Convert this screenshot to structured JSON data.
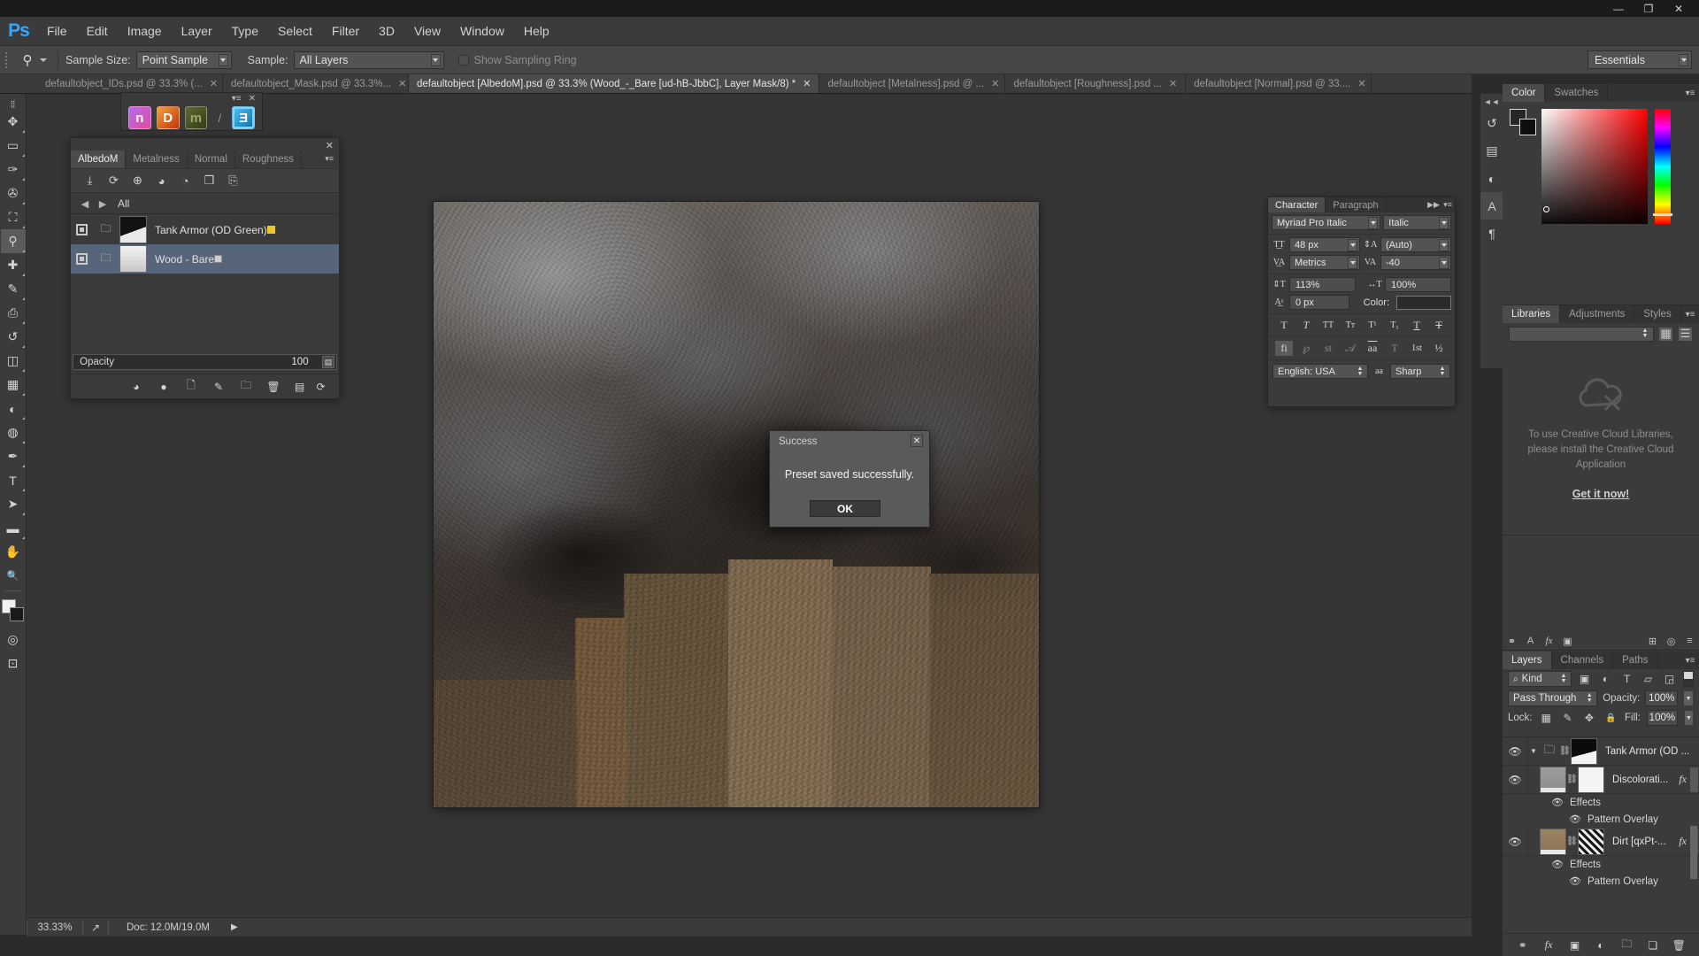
{
  "window": {
    "minimize": "—",
    "maximize": "❐",
    "close": "✕"
  },
  "menubar": {
    "logo": "Ps",
    "items": [
      "File",
      "Edit",
      "Image",
      "Layer",
      "Type",
      "Select",
      "Filter",
      "3D",
      "View",
      "Window",
      "Help"
    ]
  },
  "options_bar": {
    "sample_size_label": "Sample Size:",
    "sample_size_value": "Point Sample",
    "sample_label": "Sample:",
    "sample_value": "All Layers",
    "show_sampling_ring": "Show Sampling Ring",
    "workspace": "Essentials"
  },
  "tabs": [
    {
      "label": "defaultobject_IDs.psd @ 33.3% (...",
      "active": false,
      "close": "✕"
    },
    {
      "label": "defaultobject_Mask.psd @ 33.3%...",
      "active": false,
      "close": "✕"
    },
    {
      "label": "defaultobject [AlbedoM].psd @ 33.3% (Wood_-_Bare [ud-hB-JbbC], Layer Mask/8) *",
      "active": true,
      "close": "✕"
    },
    {
      "label": "defaultobject [Metalness].psd @ ...",
      "active": false,
      "close": "✕"
    },
    {
      "label": "defaultobject [Roughness].psd ...",
      "active": false,
      "close": "✕"
    },
    {
      "label": "defaultobject [Normal].psd @ 33....",
      "active": false,
      "close": "✕"
    }
  ],
  "toolbar": {
    "tools": [
      {
        "name": "move-tool",
        "glyph": "✥"
      },
      {
        "name": "marquee-tool",
        "glyph": "▭"
      },
      {
        "name": "lasso-tool",
        "glyph": "✑"
      },
      {
        "name": "quick-selection-tool",
        "glyph": "✇"
      },
      {
        "name": "crop-tool",
        "glyph": "⛶"
      },
      {
        "name": "eyedropper-tool",
        "glyph": "⚲"
      },
      {
        "name": "spot-healing-tool",
        "glyph": "✚"
      },
      {
        "name": "brush-tool",
        "glyph": "✎"
      },
      {
        "name": "clone-stamp-tool",
        "glyph": "⎙"
      },
      {
        "name": "history-brush-tool",
        "glyph": "↺"
      },
      {
        "name": "eraser-tool",
        "glyph": "◫"
      },
      {
        "name": "gradient-tool",
        "glyph": "▦"
      },
      {
        "name": "blur-tool",
        "glyph": "◐"
      },
      {
        "name": "dodge-tool",
        "glyph": "◍"
      },
      {
        "name": "pen-tool",
        "glyph": "✒"
      },
      {
        "name": "type-tool",
        "glyph": "T"
      },
      {
        "name": "path-selection-tool",
        "glyph": "➤"
      },
      {
        "name": "rectangle-tool",
        "glyph": "▬"
      },
      {
        "name": "hand-tool",
        "glyph": "✋"
      },
      {
        "name": "zoom-tool",
        "glyph": "🔍"
      }
    ],
    "extra": [
      {
        "name": "quick-mask-icon",
        "glyph": "◎"
      },
      {
        "name": "screen-mode-icon",
        "glyph": "⊡"
      }
    ]
  },
  "material_icons": {
    "menu_glyph": "▾≡",
    "close_glyph": "✕",
    "items": [
      {
        "name": "normal-material-icon",
        "label": "n"
      },
      {
        "name": "diffuse-material-icon",
        "label": "D"
      },
      {
        "name": "metalness-material-icon",
        "label": "m"
      },
      {
        "name": "separator-icon",
        "label": "/"
      },
      {
        "name": "export-material-icon",
        "label": "Ǝ"
      }
    ]
  },
  "material_panel": {
    "close": "✕",
    "menu": "▾≡",
    "tabs": [
      {
        "label": "AlbedoM",
        "active": true
      },
      {
        "label": "Metalness",
        "active": false
      },
      {
        "label": "Normal",
        "active": false
      },
      {
        "label": "Roughness",
        "active": false
      }
    ],
    "tools": [
      {
        "name": "import-icon",
        "glyph": "⤓"
      },
      {
        "name": "refresh-icon",
        "glyph": "⟳"
      },
      {
        "name": "add-layer-icon",
        "glyph": "⊕"
      },
      {
        "name": "apply-icon",
        "glyph": "◕"
      },
      {
        "name": "paint-icon",
        "glyph": "◔"
      },
      {
        "name": "duplicate-icon",
        "glyph": "❐"
      },
      {
        "name": "export-icon",
        "glyph": "⎘"
      }
    ],
    "nav": {
      "prev": "◀",
      "next": "▶",
      "label": "All"
    },
    "items": [
      {
        "name": "Tank Armor (OD Green)",
        "selected": false,
        "swatch": "#e8c832"
      },
      {
        "name": "Wood - Bare",
        "selected": true,
        "swatch": "#cfcfcf"
      }
    ],
    "opacity_label": "Opacity",
    "opacity_value": "100",
    "footer_icons": [
      {
        "name": "mask-icon",
        "glyph": "◕"
      },
      {
        "name": "adjustment-icon",
        "glyph": "●"
      },
      {
        "name": "new-layer-icon",
        "glyph": "🗋"
      },
      {
        "name": "brush-icon",
        "glyph": "✎"
      },
      {
        "name": "folder-icon",
        "glyph": "🗀"
      },
      {
        "name": "delete-icon",
        "glyph": "🗑"
      },
      {
        "name": "sync-icon",
        "glyph": "⟳"
      },
      {
        "name": "save-icon",
        "glyph": "▤"
      }
    ]
  },
  "dialog": {
    "title": "Success",
    "close": "✕",
    "message": "Preset saved successfully.",
    "ok_label": "OK"
  },
  "status_bar": {
    "zoom": "33.33%",
    "share_icon": "↗",
    "doc_label": "Doc: 12.0M/19.0M",
    "arrow": "▶"
  },
  "dock_strip": {
    "icons": [
      {
        "name": "history-dock-icon",
        "glyph": "↺",
        "selected": false
      },
      {
        "name": "properties-dock-icon",
        "glyph": "▤",
        "selected": false
      },
      {
        "name": "adjustments-dock-icon",
        "glyph": "◐",
        "selected": false
      },
      {
        "name": "character-dock-icon",
        "glyph": "A",
        "selected": true
      },
      {
        "name": "paragraph-dock-icon",
        "glyph": "¶",
        "selected": false
      }
    ]
  },
  "color_panel": {
    "tabs": [
      {
        "label": "Color",
        "active": true
      },
      {
        "label": "Swatches",
        "active": false
      }
    ],
    "menu": "▾≡",
    "foreground": "#262626",
    "background": "#0f0f0f"
  },
  "libraries_panel": {
    "tabs": [
      {
        "label": "Libraries",
        "active": true
      },
      {
        "label": "Adjustments",
        "active": false
      },
      {
        "label": "Styles",
        "active": false
      }
    ],
    "menu": "▾≡",
    "message_line1": "To use Creative Cloud Libraries,",
    "message_line2": "please install the Creative Cloud",
    "message_line3": "Application",
    "link": "Get it now!",
    "grid_icon": "▦",
    "list_icon": "☰"
  },
  "icon_strip": {
    "icons": [
      {
        "name": "link-layers-icon",
        "glyph": "⚭"
      },
      {
        "name": "text-icon",
        "glyph": "A"
      },
      {
        "name": "fx-icon",
        "glyph": "fx"
      },
      {
        "name": "mask-icon",
        "glyph": "▣"
      },
      {
        "name": "grid-icon",
        "glyph": "⊞"
      },
      {
        "name": "circle-icon",
        "glyph": "◎"
      },
      {
        "name": "menu-icon",
        "glyph": "≡"
      }
    ]
  },
  "layers_panel": {
    "tabs": [
      {
        "label": "Layers",
        "active": true
      },
      {
        "label": "Channels",
        "active": false
      },
      {
        "label": "Paths",
        "active": false
      }
    ],
    "menu": "▾≡",
    "filter_kind": "Kind",
    "filter_icons": [
      {
        "name": "filter-image-icon",
        "glyph": "▣"
      },
      {
        "name": "filter-adjustment-icon",
        "glyph": "◐"
      },
      {
        "name": "filter-type-icon",
        "glyph": "T"
      },
      {
        "name": "filter-shape-icon",
        "glyph": "▱"
      },
      {
        "name": "filter-smart-object-icon",
        "glyph": "◲"
      }
    ],
    "blend_mode": "Pass Through",
    "opacity_label": "Opacity:",
    "opacity_value": "100%",
    "lock_label": "Lock:",
    "lock_icons": [
      {
        "name": "lock-transparency-icon",
        "glyph": "▦"
      },
      {
        "name": "lock-image-icon",
        "glyph": "✎"
      },
      {
        "name": "lock-position-icon",
        "glyph": "✥"
      },
      {
        "name": "lock-all-icon",
        "glyph": "🔒"
      }
    ],
    "fill_label": "Fill:",
    "fill_value": "100%",
    "layers": [
      {
        "name": "Tank Armor (OD ...",
        "type": "group",
        "expanded": true,
        "fx": "",
        "effects": []
      },
      {
        "name": "Discolorati...",
        "type": "layer",
        "fx": "fx",
        "effects": [
          "Effects",
          "Pattern Overlay"
        ]
      },
      {
        "name": "Dirt [qxPt-...",
        "type": "layer",
        "fx": "fx",
        "effects": [
          "Effects",
          "Pattern Overlay"
        ]
      }
    ],
    "footer_icons": [
      {
        "name": "link-layers-icon",
        "glyph": "⚭"
      },
      {
        "name": "layer-style-icon",
        "glyph": "fx"
      },
      {
        "name": "layer-mask-icon",
        "glyph": "▣"
      },
      {
        "name": "adjustment-layer-icon",
        "glyph": "◐"
      },
      {
        "name": "new-group-icon",
        "glyph": "🗀"
      },
      {
        "name": "new-layer-icon",
        "glyph": "❏"
      },
      {
        "name": "delete-layer-icon",
        "glyph": "🗑"
      }
    ]
  },
  "character_panel": {
    "tabs": [
      {
        "label": "Character",
        "active": true
      },
      {
        "label": "Paragraph",
        "active": false
      }
    ],
    "expand": "▶▶",
    "menu": "▾≡",
    "font_family": "Myriad Pro Italic",
    "font_style": "Italic",
    "font_size": "48 px",
    "leading": "(Auto)",
    "kerning": "Metrics",
    "tracking": "-40",
    "vertical_scale": "113%",
    "horizontal_scale": "100%",
    "baseline_shift": "0 px",
    "color_label": "Color:",
    "color_value": "#2b2b2b",
    "style_buttons": [
      "T",
      "T",
      "TT",
      "Tт",
      "T¹",
      "T₁",
      "T",
      "T"
    ],
    "opentype_buttons": [
      "fi",
      "℘",
      "st",
      "𝒜",
      "aa",
      "T",
      "1st",
      "½"
    ],
    "language": "English: USA",
    "aa_icon": "aa",
    "antialiasing": "Sharp"
  }
}
